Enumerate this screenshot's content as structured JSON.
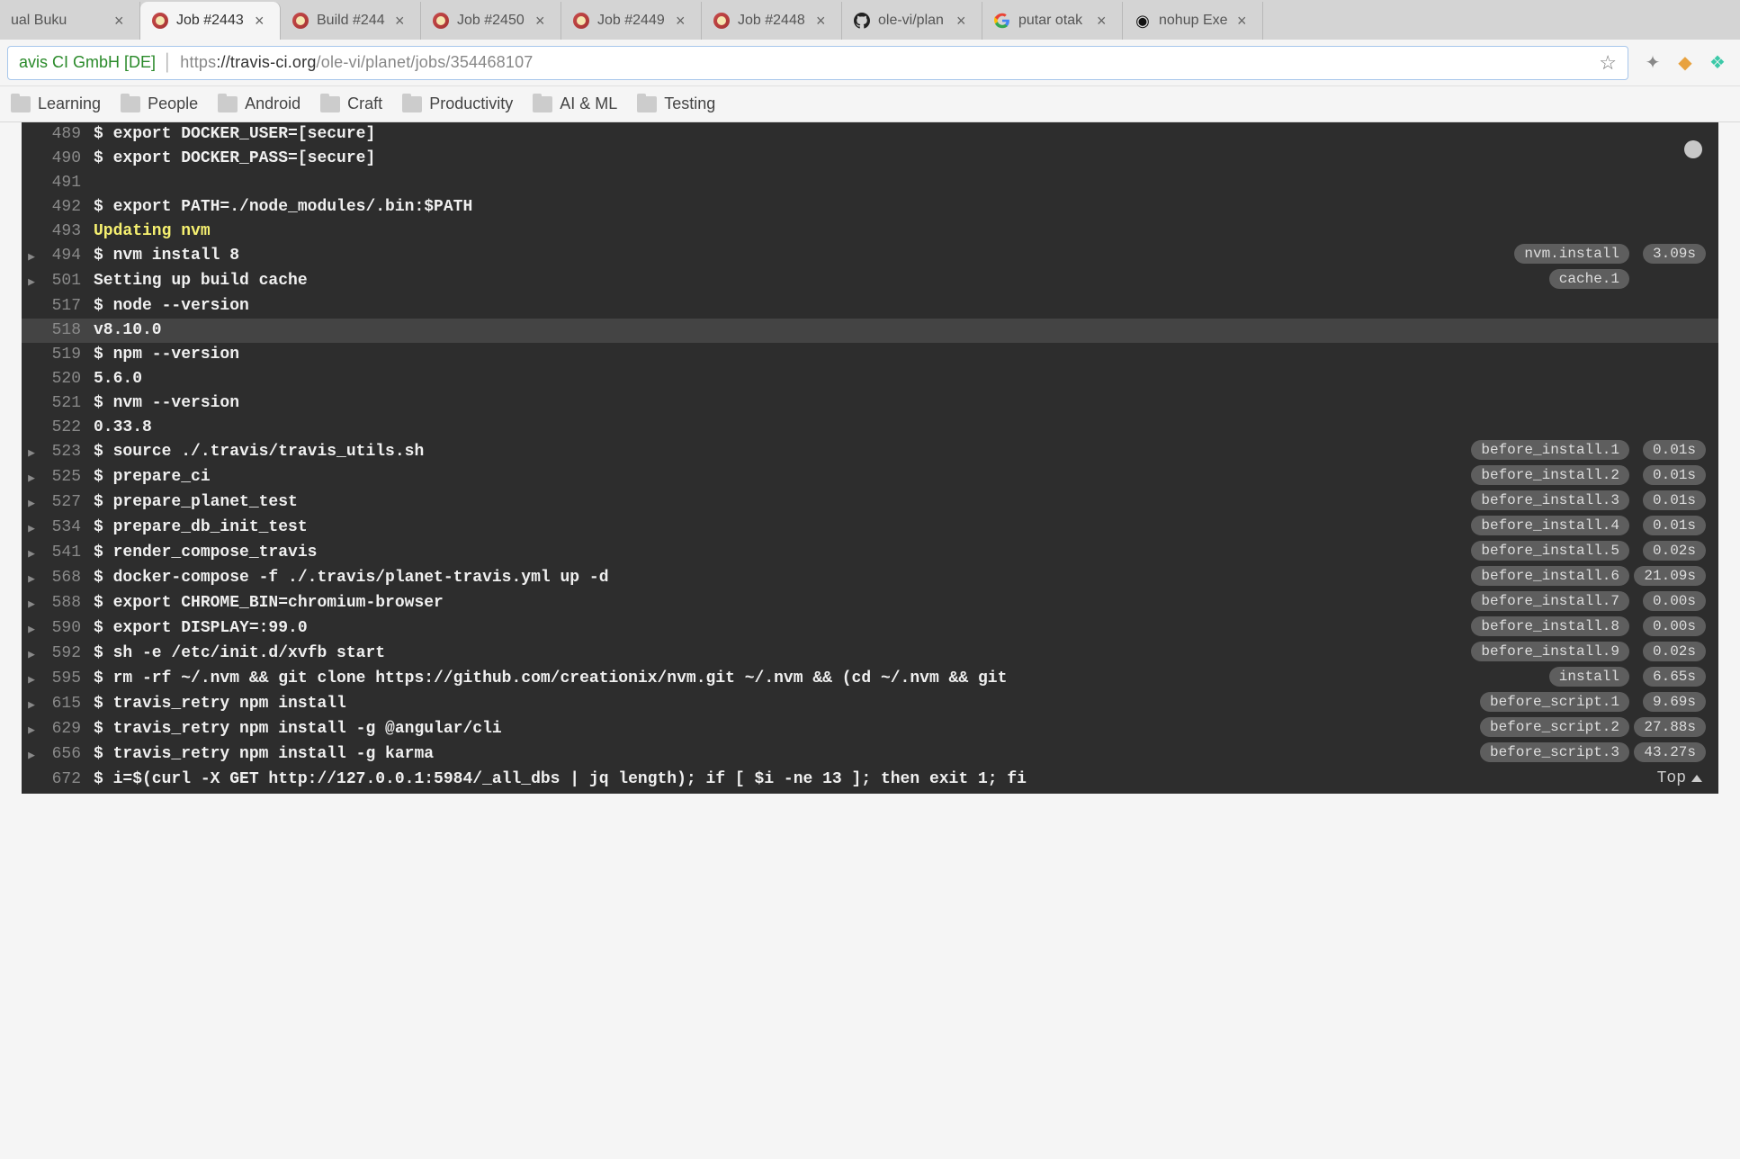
{
  "tabs": [
    {
      "title": "ual Buku",
      "favicon": "none"
    },
    {
      "title": "Job #2443",
      "favicon": "travis",
      "active": true
    },
    {
      "title": "Build #244",
      "favicon": "travis"
    },
    {
      "title": "Job #2450",
      "favicon": "travis"
    },
    {
      "title": "Job #2449",
      "favicon": "travis"
    },
    {
      "title": "Job #2448",
      "favicon": "travis"
    },
    {
      "title": "ole-vi/plan",
      "favicon": "github"
    },
    {
      "title": "putar otak",
      "favicon": "google"
    },
    {
      "title": "nohup Exe",
      "favicon": "nohup"
    }
  ],
  "address": {
    "identity": "avis CI GmbH [DE]",
    "url_protocol": "https",
    "url_host": "://travis-ci.org",
    "url_path": "/ole-vi/planet/jobs/354468107"
  },
  "bookmarks": [
    "Learning",
    "People",
    "Android",
    "Craft",
    "Productivity",
    "AI & ML",
    "Testing"
  ],
  "top_label": "Top",
  "log": [
    {
      "no": "489",
      "text": "$ export DOCKER_USER=[secure]"
    },
    {
      "no": "490",
      "text": "$ export DOCKER_PASS=[secure]"
    },
    {
      "no": "491",
      "text": ""
    },
    {
      "no": "492",
      "text": "$ export PATH=./node_modules/.bin:$PATH"
    },
    {
      "no": "493",
      "text": "Updating nvm",
      "yellow": true
    },
    {
      "no": "494",
      "text": "$ nvm install 8",
      "fold": true,
      "badge": "nvm.install",
      "time": "3.09s"
    },
    {
      "no": "501",
      "text": "Setting up build cache",
      "fold": true,
      "badge": "cache.1"
    },
    {
      "no": "517",
      "text": "$ node --version"
    },
    {
      "no": "518",
      "text": "v8.10.0",
      "hl": true
    },
    {
      "no": "519",
      "text": "$ npm --version"
    },
    {
      "no": "520",
      "text": "5.6.0"
    },
    {
      "no": "521",
      "text": "$ nvm --version"
    },
    {
      "no": "522",
      "text": "0.33.8"
    },
    {
      "no": "523",
      "text": "$ source ./.travis/travis_utils.sh",
      "fold": true,
      "badge": "before_install.1",
      "time": "0.01s"
    },
    {
      "no": "525",
      "text": "$ prepare_ci",
      "fold": true,
      "badge": "before_install.2",
      "time": "0.01s"
    },
    {
      "no": "527",
      "text": "$ prepare_planet_test",
      "fold": true,
      "badge": "before_install.3",
      "time": "0.01s"
    },
    {
      "no": "534",
      "text": "$ prepare_db_init_test",
      "fold": true,
      "badge": "before_install.4",
      "time": "0.01s"
    },
    {
      "no": "541",
      "text": "$ render_compose_travis",
      "fold": true,
      "badge": "before_install.5",
      "time": "0.02s"
    },
    {
      "no": "568",
      "text": "$ docker-compose -f ./.travis/planet-travis.yml up -d",
      "fold": true,
      "badge": "before_install.6",
      "time": "21.09s"
    },
    {
      "no": "588",
      "text": "$ export CHROME_BIN=chromium-browser",
      "fold": true,
      "badge": "before_install.7",
      "time": "0.00s"
    },
    {
      "no": "590",
      "text": "$ export DISPLAY=:99.0",
      "fold": true,
      "badge": "before_install.8",
      "time": "0.00s"
    },
    {
      "no": "592",
      "text": "$ sh -e /etc/init.d/xvfb start",
      "fold": true,
      "badge": "before_install.9",
      "time": "0.02s"
    },
    {
      "no": "595",
      "text": "$ rm -rf ~/.nvm && git clone https://github.com/creationix/nvm.git ~/.nvm && (cd ~/.nvm && git ",
      "fold": true,
      "badge": "install",
      "time": "6.65s"
    },
    {
      "no": "615",
      "text": "$ travis_retry npm install",
      "fold": true,
      "badge": "before_script.1",
      "time": "9.69s"
    },
    {
      "no": "629",
      "text": "$ travis_retry npm install -g @angular/cli",
      "fold": true,
      "badge": "before_script.2",
      "time": "27.88s"
    },
    {
      "no": "656",
      "text": "$ travis_retry npm install -g karma",
      "fold": true,
      "badge": "before_script.3",
      "time": "43.27s"
    },
    {
      "no": "672",
      "text": "$ i=$(curl -X GET http://127.0.0.1:5984/_all_dbs | jq length); if [ $i -ne 13 ]; then exit 1; fi"
    }
  ]
}
